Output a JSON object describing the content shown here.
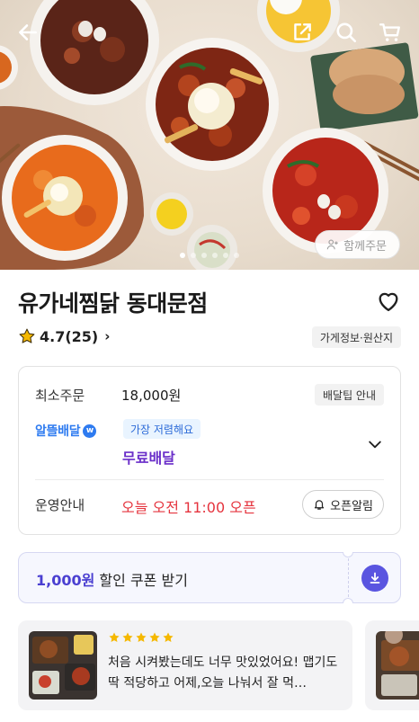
{
  "header": {
    "back_icon": "arrow-left-icon",
    "share_icon": "share-icon",
    "search_icon": "search-icon",
    "cart_icon": "cart-icon"
  },
  "hero": {
    "together_order_label": "함께주문",
    "together_icon": "people-icon",
    "carousel_total": 6,
    "carousel_active_index": 0
  },
  "store": {
    "name": "유가네찜닭 동대문점",
    "rating": "4.7(25)",
    "rating_chevron": "›",
    "info_chip": "가게정보·원산지",
    "favorite_icon": "heart-outline-icon"
  },
  "info": {
    "min_order_label": "최소주문",
    "min_order_value": "18,000원",
    "tip_chip": "배달팁 안내",
    "brand_label": "알뜰배달",
    "brand_badge": "w",
    "cheapest_chip": "가장 저렴해요",
    "free_delivery": "무료배달",
    "hours_label": "운영안내",
    "open_time": "오늘 오전 11:00 오픈",
    "alarm_label": "오픈알림"
  },
  "coupon": {
    "amount": "1,000원",
    "text": " 할인 쿠폰 받기"
  },
  "review": {
    "stars": 5,
    "text": "처음 시켜봤는데도 너무 맛있었어요! 맵기도 딱 적당하고 어제,오늘 나눠서 잘 먹…"
  },
  "colors": {
    "accent_purple": "#6a2ec9",
    "coupon_purple": "#4a3fd1",
    "open_red": "#e5343e",
    "brand_blue": "#2e7bf0",
    "star_yellow": "#f5b800"
  }
}
